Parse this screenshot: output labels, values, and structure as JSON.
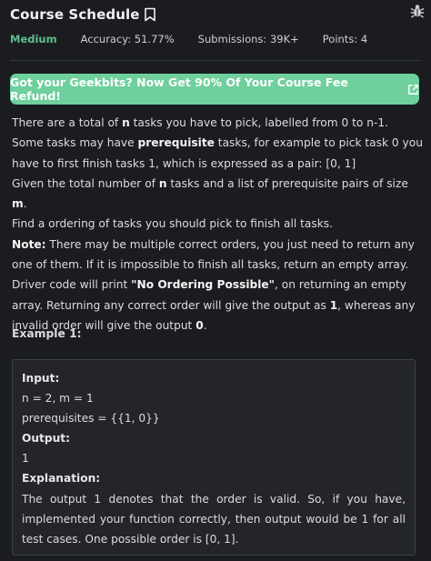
{
  "header": {
    "title": "Course Schedule",
    "bookmark_icon": "bookmark-icon",
    "bug_icon": "bug-icon"
  },
  "meta": {
    "difficulty": "Medium",
    "accuracy": "Accuracy: 51.77%",
    "submissions": "Submissions: 39K+",
    "points": "Points: 4"
  },
  "banner": {
    "text": "Got your Geekbits? Now Get 90% Of Your Course Fee Refund!",
    "icon": "external-link-icon",
    "color": "#6fcf9d"
  },
  "description": {
    "p1_a": "There are a total of ",
    "p1_n": "n",
    "p1_b": " tasks you have to pick, labelled from 0 to n-1. Some tasks may have ",
    "p1_prereq": "prerequisite",
    "p1_c": " tasks, for example to pick task 0 you have to first finish tasks 1, which is expressed as a pair: [0, 1]",
    "p2_a": "Given the total number of ",
    "p2_n": "n",
    "p2_b": " tasks and a list of prerequisite pairs of size ",
    "p2_m": "m",
    "p2_c": ".",
    "p3": "Find a ordering of tasks you should pick to finish all tasks.",
    "note_label": "Note:",
    "note_a": " There may be multiple correct orders, you just need to return any one of them. If it is impossible to finish all tasks, return an empty array. Driver code will print ",
    "note_quote": "\"No Ordering Possible\"",
    "note_b": ", on returning an empty",
    "note_c": "array. Returning any correct order will give the output as ",
    "note_one": "1",
    "note_d": ", whereas any invalid order will give the output ",
    "note_zero": "0",
    "note_e": "."
  },
  "example": {
    "title": "Example 1:",
    "input_label": "Input:",
    "input_line1": "n = 2, m = 1",
    "input_line2": "prerequisites = {{1, 0}}",
    "output_label": "Output:",
    "output_value": "1",
    "explanation_label": "Explanation:",
    "explanation_text": "The output 1 denotes that the order is valid. So, if you have, implemented your function correctly, then output would be 1 for all test cases. One possible order is [0, 1]."
  }
}
